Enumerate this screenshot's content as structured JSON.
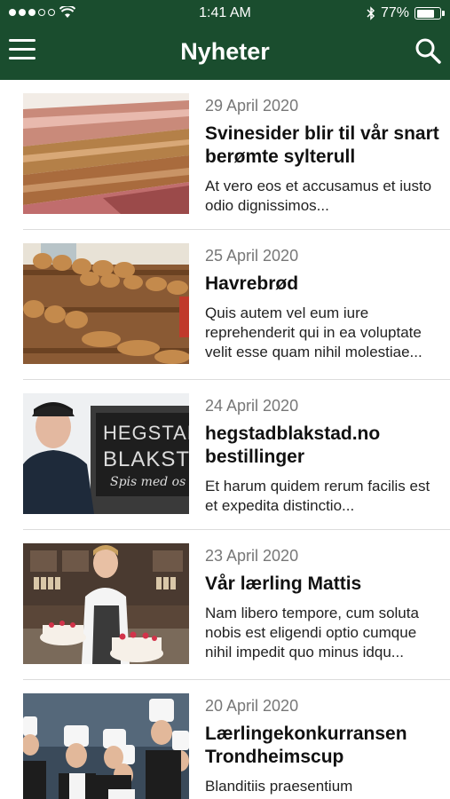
{
  "status_bar": {
    "time": "1:41 AM",
    "battery": "77%",
    "battery_level": 0.77,
    "signal_bars": 3,
    "icons": [
      "signal-dots-icon",
      "wifi-icon",
      "bluetooth-icon",
      "battery-icon"
    ]
  },
  "nav": {
    "title": "Nyheter",
    "menu_icon": "hamburger-menu-icon",
    "search_icon": "search-icon"
  },
  "theme": {
    "header_color": "#1a4d2e",
    "date_color": "#777777"
  },
  "news": [
    {
      "date": "29 April 2020",
      "title": "Svinesider blir til vår snart berømte sylterull",
      "excerpt": "At vero eos et accusamus et iusto odio dignissimos..."
    },
    {
      "date": "25 April 2020",
      "title": "Havrebrød",
      "excerpt": "Quis autem vel eum iure reprehenderit qui in ea voluptate velit esse quam nihil molestiae..."
    },
    {
      "date": "24 April 2020",
      "title": "hegstadblakstad.no bestillinger",
      "excerpt": "Et harum quidem rerum facilis est et expedita distinctio..."
    },
    {
      "date": "23 April 2020",
      "title": "Vår lærling Mattis",
      "excerpt": "Nam libero tempore, cum soluta nobis est eligendi optio cumque nihil impedit quo minus idqu..."
    },
    {
      "date": "20 April 2020",
      "title": "Lærlingekonkurransen Trondheimscup",
      "excerpt": "Blanditiis praesentium"
    }
  ],
  "photo_texts": {
    "shop_sign_line1": "HEGSTAD",
    "shop_sign_line2": "BLAKST",
    "shop_sign_line3": "Spis med os"
  }
}
